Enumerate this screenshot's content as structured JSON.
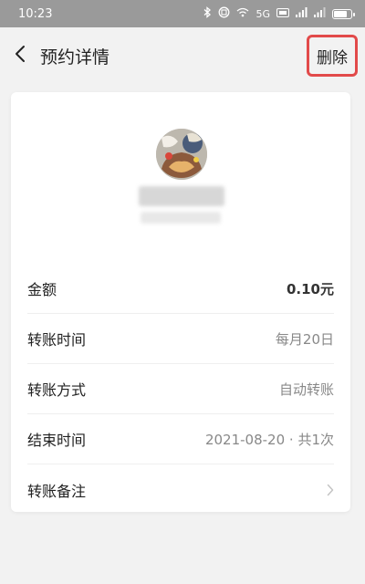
{
  "status_bar": {
    "time": "10:23",
    "icons": [
      "bluetooth-icon",
      "nfc-icon",
      "wifi-icon",
      "hd-icon",
      "signal-icon",
      "signal-icon",
      "battery-icon"
    ],
    "network": "5G",
    "battery_percent": 75
  },
  "nav": {
    "title": "预约详情",
    "delete_label": "删除"
  },
  "details": [
    {
      "label": "金额",
      "value": "0.10元"
    },
    {
      "label": "转账时间",
      "value": "每月20日"
    },
    {
      "label": "转账方式",
      "value": "自动转账"
    },
    {
      "label": "结束时间",
      "value": "2021-08-20 · 共1次"
    },
    {
      "label": "转账备注",
      "value": ""
    }
  ],
  "colors": {
    "highlight": "#e24a4a",
    "status_bar": "#9a9a9a",
    "background": "#f2f2f2"
  }
}
